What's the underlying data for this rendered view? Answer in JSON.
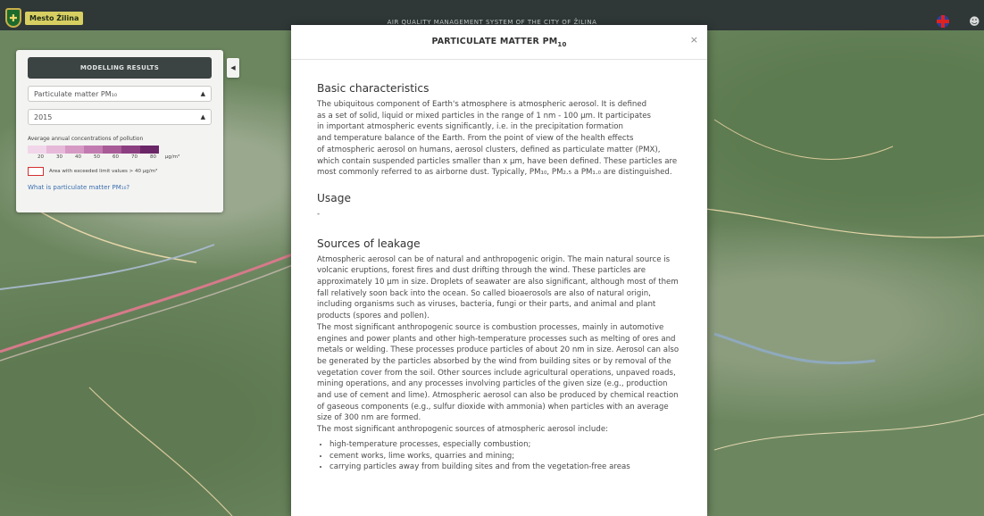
{
  "header": {
    "logo_text": "Mesto Žilina",
    "app_title": "AIR QUALITY MANAGEMENT SYSTEM OF THE CITY OF ŽILINA"
  },
  "panel": {
    "header": "MODELLING RESULTS",
    "pollutant": "Particulate matter PM₁₀",
    "year": "2015",
    "legend_title": "Average annual concentrations of pollution",
    "legend_colors": [
      "#f1d6ea",
      "#e6b9d9",
      "#d699c4",
      "#c27bb0",
      "#a85b97",
      "#8c3f80",
      "#6b2668"
    ],
    "legend_ticks": [
      "20",
      "30",
      "40",
      "50",
      "60",
      "70",
      "80",
      "µg/m³"
    ],
    "exceed_label": "Area with exceeded limit values  > 40 µg/m³",
    "link": "What is particulate matter PM₁₀?"
  },
  "modal": {
    "title": "PARTICULATE MATTER PM",
    "title_sub": "10",
    "close": "×",
    "sections": {
      "basic_title": "Basic characteristics",
      "basic_lines": [
        "The ubiquitous component of Earth's atmosphere is atmospheric aerosol. It is defined",
        "as a set of solid, liquid or mixed particles in the range of 1 nm - 100 µm. It participates",
        "in important atmospheric events significantly, i.e. in the precipitation formation",
        "and temperature balance of the Earth. From the point of view of the health effects",
        "of atmospheric aerosol on humans, aerosol clusters, defined as particulate matter (PMX),",
        "which contain suspended particles smaller than x µm, have been defined. These particles are",
        "most commonly referred to as airborne dust. Typically, PM₁₀, PM₂.₅ a PM₁.₀ are distinguished."
      ],
      "usage_title": "Usage",
      "usage_text": "-",
      "sources_title": "Sources of leakage",
      "sources_lines": [
        "Atmospheric aerosol can be of natural and anthropogenic origin. The main natural source is",
        "volcanic eruptions, forest fires and dust drifting through the wind. These particles are",
        "approximately 10 µm in size. Droplets of seawater are also significant, although most of them",
        "fall relatively soon back into the ocean. So called bioaerosols are also of natural origin,",
        "including organisms such as viruses, bacteria, fungi or their parts, and animal and plant",
        "products (spores and pollen).",
        "The most significant anthropogenic source is combustion processes, mainly in automotive",
        "engines and power plants and other high-temperature processes such as melting of ores and",
        "metals or welding. These processes produce particles of about 20 nm in size. Aerosol can also",
        "be generated by the particles absorbed by the wind from building sites or by removal of the",
        "vegetation cover from the soil. Other sources include agricultural operations, unpaved roads,",
        "mining operations, and any processes involving particles of the given size (e.g., production",
        "and use of cement and lime). Atmospheric aerosol can also be produced by chemical reaction",
        "of gaseous components (e.g., sulfur dioxide with ammonia) when particles with an average",
        "size of 300 nm are formed.",
        "The most significant anthropogenic sources of atmospheric aerosol include:"
      ],
      "sources_list": [
        "high-temperature processes, especially combustion;",
        "cement works, lime works, quarries and mining;",
        "carrying particles away from building sites and from the vegetation-free areas"
      ]
    }
  }
}
